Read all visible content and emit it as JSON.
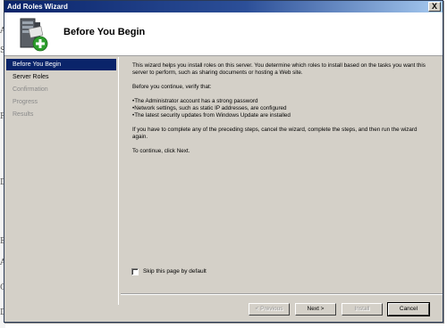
{
  "background": {
    "edge_chars": [
      "A",
      "S",
      "F",
      "D",
      "E",
      "A",
      "C",
      "D"
    ]
  },
  "window": {
    "title": "Add Roles Wizard",
    "close_glyph": "X"
  },
  "header": {
    "title": "Before You Begin",
    "icon": "server-add-icon"
  },
  "sidebar": {
    "items": [
      {
        "label": "Before You Begin",
        "state": "active"
      },
      {
        "label": "Server Roles",
        "state": "normal"
      },
      {
        "label": "Confirmation",
        "state": "disabled"
      },
      {
        "label": "Progress",
        "state": "disabled"
      },
      {
        "label": "Results",
        "state": "disabled"
      }
    ]
  },
  "content": {
    "intro": "This wizard helps you install roles on this server. You determine which roles to install based on the tasks you want this server to perform, such as sharing documents or hosting a Web site.",
    "verify_heading": "Before you continue, verify that:",
    "checklist": [
      "The Administrator account has a strong password",
      "Network settings, such as static IP addresses, are configured",
      "The latest security updates from Windows Update are installed"
    ],
    "cancel_note": "If you have to complete any of the preceding steps, cancel the wizard, complete the steps, and then run the wizard again.",
    "continue_note": "To continue, click Next.",
    "skip_label": "Skip this page by default",
    "skip_checked": false
  },
  "footer": {
    "previous_label": "< Previous",
    "next_label": "Next >",
    "install_label": "Install",
    "cancel_label": "Cancel"
  },
  "colors": {
    "title_bar": "#0a246a",
    "selected_nav": "#0a246a",
    "dialog_face": "#d4d0c8"
  }
}
